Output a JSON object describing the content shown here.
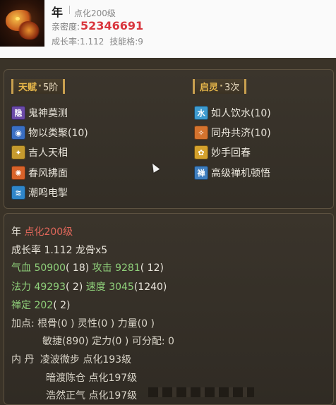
{
  "header": {
    "name": "年",
    "level": "点化200级",
    "intimacy_label": "亲密度:",
    "intimacy_value": "52346691",
    "growth_label": "成长率:1.112",
    "skill_slots": "技能格:9"
  },
  "talent": {
    "label": "天赋",
    "dot": "·",
    "value": "5阶"
  },
  "awaken": {
    "label": "启灵",
    "dot": "·",
    "value": "3次"
  },
  "skills_left": [
    {
      "name": "鬼神莫测",
      "icon": "ghost-skill-icon",
      "glyph": "隐",
      "color": "#6b4aa8"
    },
    {
      "name": "物以类聚(10)",
      "icon": "gather-skill-icon",
      "glyph": "◉",
      "color": "#3a6fc4"
    },
    {
      "name": "吉人天相",
      "icon": "fortune-skill-icon",
      "glyph": "✦",
      "color": "#c59a2e"
    },
    {
      "name": "春风拂面",
      "icon": "spring-wind-skill-icon",
      "glyph": "✺",
      "color": "#d8632a"
    },
    {
      "name": "潮鸣电掣",
      "icon": "thunder-tide-skill-icon",
      "glyph": "≋",
      "color": "#2f86c9"
    }
  ],
  "skills_right": [
    {
      "name": "如人饮水(10)",
      "icon": "drink-water-skill-icon",
      "glyph": "水",
      "color": "#3e9bd0"
    },
    {
      "name": "同舟共济(10)",
      "icon": "same-boat-skill-icon",
      "glyph": "✧",
      "color": "#d4732e"
    },
    {
      "name": "妙手回春",
      "icon": "heal-skill-icon",
      "glyph": "✿",
      "color": "#d4a12c"
    },
    {
      "name": "高级禅机顿悟",
      "icon": "zen-skill-icon",
      "glyph": "禅",
      "color": "#3f7fc0"
    }
  ],
  "details": {
    "name": "年",
    "level": "点化200级",
    "growth_line": "成长率 1.112 龙骨x5",
    "hp_label": "气血",
    "hp_value": "50900",
    "hp_extra": "( 18)",
    "atk_label": "攻击",
    "atk_value": "9281",
    "atk_extra": "( 12)",
    "mp_label": "法力",
    "mp_value": "49293",
    "mp_extra": "( 2)",
    "spd_label": "速度",
    "spd_value": "3045",
    "spd_extra": "(1240)",
    "zen_label": "禅定",
    "zen_value": "202",
    "zen_extra": "( 2)",
    "points_line1": "加点:  根骨(0 ) 灵性(0 ) 力量(0 )",
    "points_line2": "敏捷(890) 定力(0 ) 可分配: 0",
    "inner_label": "内  丹",
    "inner1": "凌波微步 点化193级",
    "inner2": "暗渡陈仓 点化197级",
    "inner3": "浩然正气 点化197级"
  }
}
